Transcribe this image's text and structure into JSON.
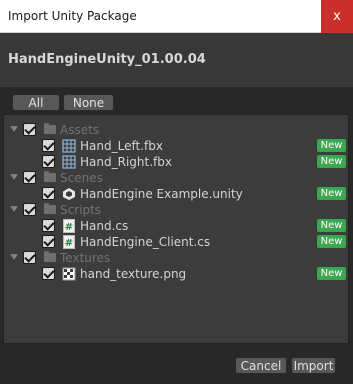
{
  "window": {
    "title": "Import Unity Package",
    "close_glyph": "x"
  },
  "package": {
    "name": "HandEngineUnity_01.00.04"
  },
  "select_buttons": {
    "all": "All",
    "none": "None"
  },
  "tree": {
    "folders": [
      {
        "label": "Assets",
        "checked": true,
        "expanded": true,
        "items": [
          {
            "label": "Hand_Left.fbx",
            "icon": "mesh-grid-icon",
            "checked": true,
            "badge": "New"
          },
          {
            "label": "Hand_Right.fbx",
            "icon": "mesh-grid-icon",
            "checked": true,
            "badge": "New"
          }
        ]
      },
      {
        "label": "Scenes",
        "checked": true,
        "expanded": true,
        "items": [
          {
            "label": "HandEngine Example.unity",
            "icon": "unity-scene-icon",
            "checked": true,
            "badge": "New"
          }
        ]
      },
      {
        "label": "Scripts",
        "checked": true,
        "expanded": true,
        "items": [
          {
            "label": "Hand.cs",
            "icon": "csharp-script-icon",
            "checked": true,
            "badge": "New"
          },
          {
            "label": "HandEngine_Client.cs",
            "icon": "csharp-script-icon",
            "checked": true,
            "badge": "New"
          }
        ]
      },
      {
        "label": "Textures",
        "checked": true,
        "expanded": true,
        "items": [
          {
            "label": "hand_texture.png",
            "icon": "texture-icon",
            "checked": true,
            "badge": "New"
          }
        ]
      }
    ]
  },
  "footer": {
    "cancel": "Cancel",
    "import": "Import"
  },
  "colors": {
    "badge": "#3aa74f",
    "close": "#c9302c",
    "panel": "#3c3c3c",
    "background": "#282828"
  }
}
